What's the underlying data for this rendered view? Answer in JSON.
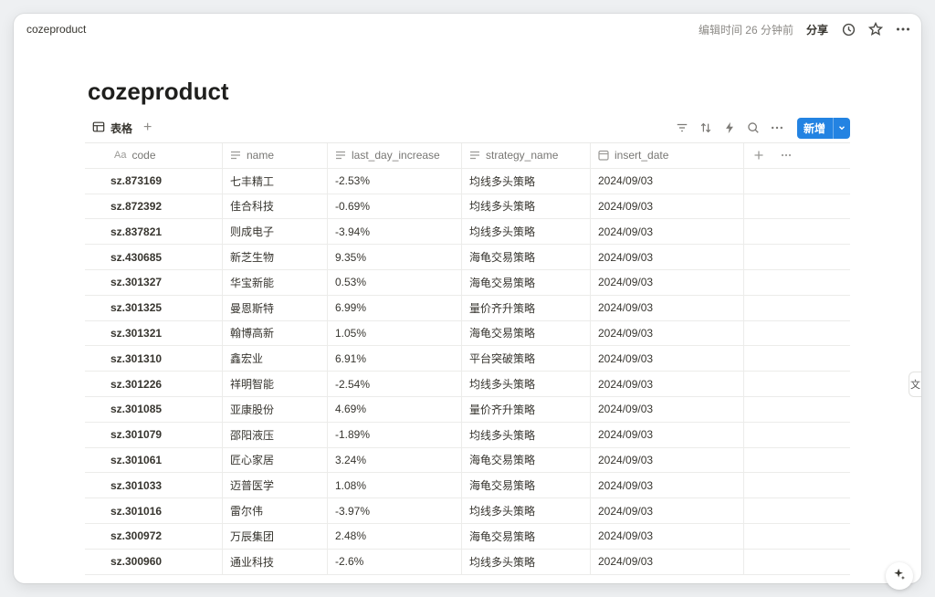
{
  "topbar": {
    "breadcrumb": "cozeproduct",
    "edited": "编辑时间 26 分钟前",
    "share": "分享"
  },
  "page": {
    "title": "cozeproduct"
  },
  "viewbar": {
    "tab_label": "表格",
    "new_button": "新增"
  },
  "table": {
    "columns": {
      "code_prefix": "Aa",
      "code": "code",
      "name": "name",
      "increase": "last_day_increase",
      "strategy": "strategy_name",
      "date": "insert_date"
    },
    "rows": [
      {
        "code": "sz.873169",
        "name": "七丰精工",
        "increase": "-2.53%",
        "strategy": "均线多头策略",
        "date": "2024/09/03"
      },
      {
        "code": "sz.872392",
        "name": "佳合科技",
        "increase": "-0.69%",
        "strategy": "均线多头策略",
        "date": "2024/09/03"
      },
      {
        "code": "sz.837821",
        "name": "则成电子",
        "increase": "-3.94%",
        "strategy": "均线多头策略",
        "date": "2024/09/03"
      },
      {
        "code": "sz.430685",
        "name": "新芝生物",
        "increase": "9.35%",
        "strategy": "海龟交易策略",
        "date": "2024/09/03"
      },
      {
        "code": "sz.301327",
        "name": "华宝新能",
        "increase": "0.53%",
        "strategy": "海龟交易策略",
        "date": "2024/09/03"
      },
      {
        "code": "sz.301325",
        "name": "曼恩斯特",
        "increase": "6.99%",
        "strategy": "量价齐升策略",
        "date": "2024/09/03"
      },
      {
        "code": "sz.301321",
        "name": "翰博高新",
        "increase": "1.05%",
        "strategy": "海龟交易策略",
        "date": "2024/09/03"
      },
      {
        "code": "sz.301310",
        "name": "鑫宏业",
        "increase": "6.91%",
        "strategy": "平台突破策略",
        "date": "2024/09/03"
      },
      {
        "code": "sz.301226",
        "name": "祥明智能",
        "increase": "-2.54%",
        "strategy": "均线多头策略",
        "date": "2024/09/03"
      },
      {
        "code": "sz.301085",
        "name": "亚康股份",
        "increase": "4.69%",
        "strategy": "量价齐升策略",
        "date": "2024/09/03"
      },
      {
        "code": "sz.301079",
        "name": "邵阳液压",
        "increase": "-1.89%",
        "strategy": "均线多头策略",
        "date": "2024/09/03"
      },
      {
        "code": "sz.301061",
        "name": "匠心家居",
        "increase": "3.24%",
        "strategy": "海龟交易策略",
        "date": "2024/09/03"
      },
      {
        "code": "sz.301033",
        "name": "迈普医学",
        "increase": "1.08%",
        "strategy": "海龟交易策略",
        "date": "2024/09/03"
      },
      {
        "code": "sz.301016",
        "name": "雷尔伟",
        "increase": "-3.97%",
        "strategy": "均线多头策略",
        "date": "2024/09/03"
      },
      {
        "code": "sz.300972",
        "name": "万辰集团",
        "increase": "2.48%",
        "strategy": "海龟交易策略",
        "date": "2024/09/03"
      },
      {
        "code": "sz.300960",
        "name": "通业科技",
        "increase": "-2.6%",
        "strategy": "均线多头策略",
        "date": "2024/09/03"
      }
    ]
  },
  "side_tab": {
    "label": "文"
  },
  "colors": {
    "accent": "#2383e2",
    "text": "#37352f",
    "muted": "#787774",
    "border": "#ececea"
  },
  "icons": [
    "history-icon",
    "star-icon",
    "more-icon",
    "table-view-icon",
    "filter-icon",
    "sort-icon",
    "automation-icon",
    "search-icon",
    "sparkle-icon"
  ]
}
